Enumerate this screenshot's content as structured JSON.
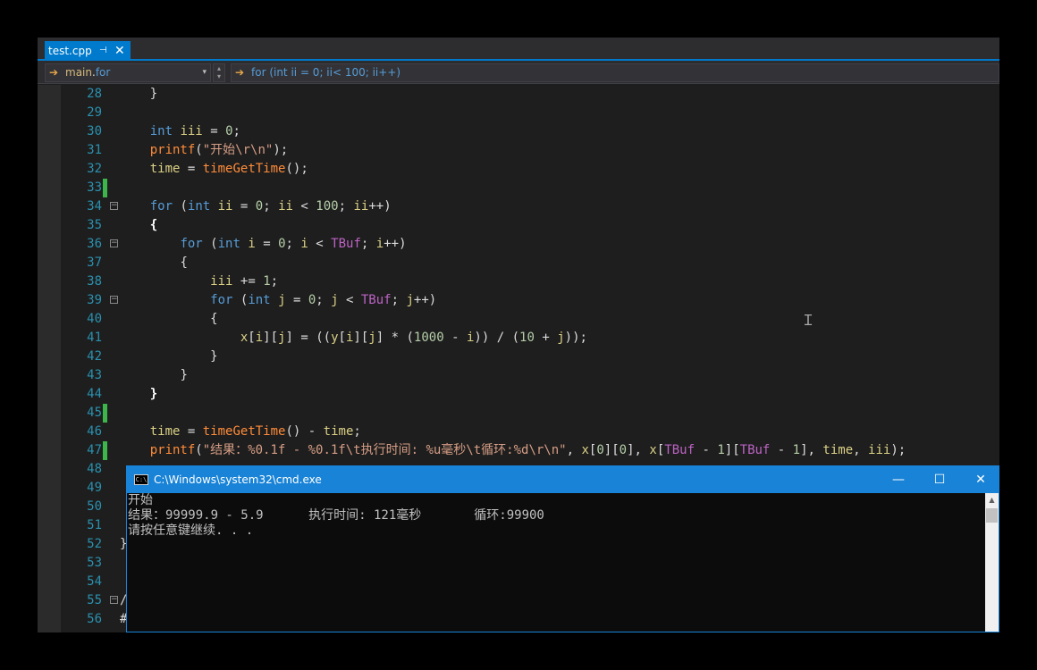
{
  "ide": {
    "tab": {
      "label": "test.cpp",
      "pin_icon": "pin-icon",
      "close_glyph": "✕"
    },
    "nav": {
      "left_scope": "main",
      "left_member": "for",
      "right_text": "for (int ii = 0; ii< 100; ii++)"
    },
    "code_lines": [
      {
        "n": "28",
        "text": "    }"
      },
      {
        "n": "29",
        "text": ""
      },
      {
        "n": "30",
        "text": "    int iii = 0;"
      },
      {
        "n": "31",
        "text": "    printf(\"开始\\r\\n\");"
      },
      {
        "n": "32",
        "text": "    time = timeGetTime();"
      },
      {
        "n": "33",
        "text": ""
      },
      {
        "n": "34",
        "text": "    for (int ii = 0; ii < 100; ii++)"
      },
      {
        "n": "35",
        "text": "    {"
      },
      {
        "n": "36",
        "text": "        for (int i = 0; i < TBuf; i++)"
      },
      {
        "n": "37",
        "text": "        {"
      },
      {
        "n": "38",
        "text": "            iii += 1;"
      },
      {
        "n": "39",
        "text": "            for (int j = 0; j < TBuf; j++)"
      },
      {
        "n": "40",
        "text": "            {"
      },
      {
        "n": "41",
        "text": "                x[i][j] = ((y[i][j] * (1000 - i)) / (10 + j));"
      },
      {
        "n": "42",
        "text": "            }"
      },
      {
        "n": "43",
        "text": "        }"
      },
      {
        "n": "44",
        "text": "    }"
      },
      {
        "n": "45",
        "text": ""
      },
      {
        "n": "46",
        "text": "    time = timeGetTime() - time;"
      },
      {
        "n": "47",
        "text": "    printf(\"结果：%0.1f - %0.1f\\t执行时间: %u毫秒\\t循环:%d\\r\\n\", x[0][0], x[TBuf - 1][TBuf - 1], time, iii);"
      },
      {
        "n": "48",
        "text": ""
      },
      {
        "n": "49",
        "text": ""
      },
      {
        "n": "50",
        "text": ""
      },
      {
        "n": "51",
        "text": ""
      },
      {
        "n": "52",
        "text": "}"
      },
      {
        "n": "53",
        "text": ""
      },
      {
        "n": "54",
        "text": ""
      },
      {
        "n": "55",
        "text": "/"
      },
      {
        "n": "56",
        "text": "#"
      }
    ]
  },
  "console": {
    "title": "C:\\Windows\\system32\\cmd.exe",
    "icon": "cmd-icon",
    "icon_text": "C:\\",
    "output_lines": [
      "开始",
      "结果：99999.9 - 5.9      执行时间: 121毫秒       循环:99900",
      "请按任意键继续. . ."
    ],
    "buttons": {
      "minimize": "—",
      "maximize": "☐",
      "close": "✕"
    }
  },
  "colors": {
    "editor_bg": "#1e1e1e",
    "accent": "#007acc",
    "line_number": "#2b91af",
    "keyword": "#569cd6",
    "function": "#ff8c3a",
    "string": "#d69d85",
    "number": "#b5cea8",
    "macro": "#bd63c5",
    "change_marker": "#3cb54a",
    "console_title": "#1883d7"
  }
}
